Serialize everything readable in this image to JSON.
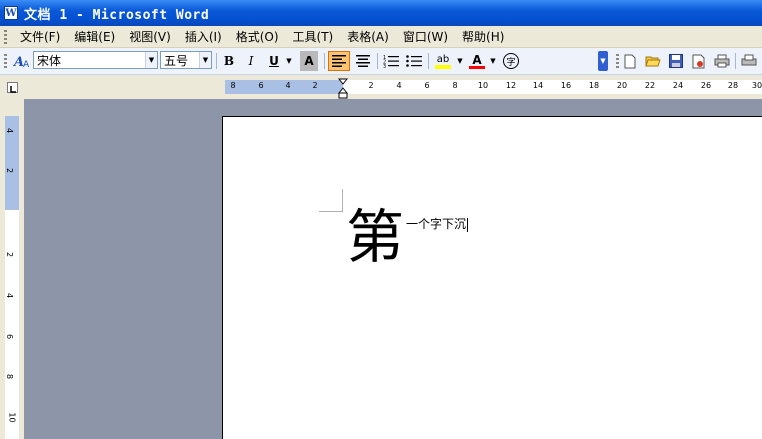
{
  "window": {
    "title": "文档 1 - Microsoft Word",
    "app_icon": "W"
  },
  "menubar": {
    "items": [
      {
        "label": "文件(F)"
      },
      {
        "label": "编辑(E)"
      },
      {
        "label": "视图(V)"
      },
      {
        "label": "插入(I)"
      },
      {
        "label": "格式(O)"
      },
      {
        "label": "工具(T)"
      },
      {
        "label": "表格(A)"
      },
      {
        "label": "窗口(W)"
      },
      {
        "label": "帮助(H)"
      }
    ]
  },
  "toolbar": {
    "style_icon": "styles-icon",
    "font_name": "宋体",
    "font_size": "五号",
    "bold_label": "B",
    "italic_label": "I",
    "underline_label": "U",
    "shading_label": "A",
    "font_color_label": "A",
    "enclose_label": "字",
    "highlight_label": "ab",
    "highlight_color": "#ffff00",
    "font_color": "#ff0000"
  },
  "hruler": {
    "left_numbers": [
      "8",
      "6",
      "4",
      "2"
    ],
    "right_numbers": [
      "2",
      "4",
      "6",
      "8",
      "10",
      "12",
      "14",
      "16",
      "18",
      "20",
      "22",
      "24",
      "26",
      "28",
      "30"
    ]
  },
  "vruler": {
    "top_numbers": [
      "4",
      "2"
    ],
    "bottom_numbers": [
      "2",
      "4",
      "6",
      "8",
      "10"
    ]
  },
  "document": {
    "dropcap": "第",
    "text": "一个字下沉"
  },
  "colors": {
    "title_bar": "#0450d0",
    "menu_bg": "#ece9d8",
    "toolbar_bg": "#eef2fb",
    "workspace": "#8c96a8",
    "active_button": "#ffc473"
  }
}
